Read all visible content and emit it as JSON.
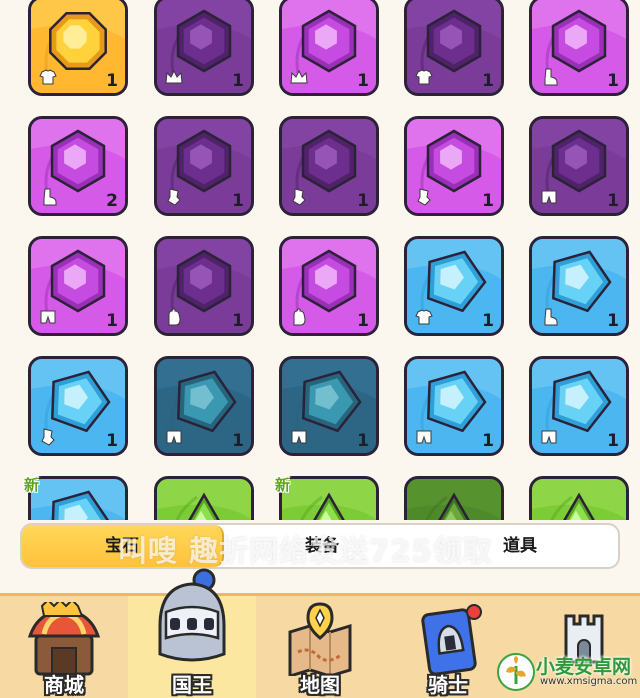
{
  "inventory": {
    "new_tag": "新",
    "items": [
      {
        "rarity": "legendary",
        "shape": "octagon",
        "slot": "shirt-icon",
        "count": "1",
        "new": false
      },
      {
        "rarity": "epic-dark",
        "shape": "hexagon",
        "slot": "crown-icon",
        "count": "1",
        "new": false
      },
      {
        "rarity": "epic",
        "shape": "hexagon",
        "slot": "crown-icon",
        "count": "1",
        "new": false
      },
      {
        "rarity": "epic-dark",
        "shape": "hexagon",
        "slot": "shirt-icon",
        "count": "1",
        "new": false
      },
      {
        "rarity": "epic",
        "shape": "hexagon",
        "slot": "boot-icon",
        "count": "1",
        "new": false
      },
      {
        "rarity": "epic",
        "shape": "hexagon",
        "slot": "boot-icon",
        "count": "2",
        "new": false
      },
      {
        "rarity": "epic-dark",
        "shape": "hexagon",
        "slot": "gauntlet-icon",
        "count": "1",
        "new": false
      },
      {
        "rarity": "epic-dark",
        "shape": "hexagon",
        "slot": "gauntlet-icon",
        "count": "1",
        "new": false
      },
      {
        "rarity": "epic",
        "shape": "hexagon",
        "slot": "gauntlet-icon",
        "count": "1",
        "new": false
      },
      {
        "rarity": "epic-dark",
        "shape": "hexagon",
        "slot": "shorts-icon",
        "count": "1",
        "new": false
      },
      {
        "rarity": "epic",
        "shape": "hexagon",
        "slot": "shorts-icon",
        "count": "1",
        "new": false
      },
      {
        "rarity": "epic-dark",
        "shape": "hexagon",
        "slot": "glove-icon",
        "count": "1",
        "new": false
      },
      {
        "rarity": "epic",
        "shape": "hexagon",
        "slot": "glove-icon",
        "count": "1",
        "new": false
      },
      {
        "rarity": "rare",
        "shape": "pentagon",
        "slot": "shirt-icon",
        "count": "1",
        "new": false
      },
      {
        "rarity": "rare",
        "shape": "pentagon",
        "slot": "boot-icon",
        "count": "1",
        "new": false
      },
      {
        "rarity": "rare",
        "shape": "pentagon",
        "slot": "gauntlet-icon",
        "count": "1",
        "new": false
      },
      {
        "rarity": "rare-dark",
        "shape": "pentagon",
        "slot": "shorts-icon",
        "count": "1",
        "new": false
      },
      {
        "rarity": "rare-dark",
        "shape": "pentagon",
        "slot": "shorts-icon",
        "count": "1",
        "new": false
      },
      {
        "rarity": "rare",
        "shape": "pentagon",
        "slot": "shorts-icon",
        "count": "1",
        "new": false
      },
      {
        "rarity": "rare",
        "shape": "pentagon",
        "slot": "shorts-icon",
        "count": "1",
        "new": false
      },
      {
        "rarity": "rare",
        "shape": "pentagon",
        "slot": "",
        "count": "",
        "new": true
      },
      {
        "rarity": "uncommon",
        "shape": "triangle",
        "slot": "",
        "count": "",
        "new": false
      },
      {
        "rarity": "uncommon",
        "shape": "triangle",
        "slot": "",
        "count": "",
        "new": true
      },
      {
        "rarity": "uncommon-dark",
        "shape": "triangle",
        "slot": "",
        "count": "",
        "new": false
      },
      {
        "rarity": "uncommon",
        "shape": "triangle",
        "slot": "",
        "count": "",
        "new": false
      }
    ]
  },
  "tabs": {
    "gems": "宝石",
    "equipment": "装备",
    "items": "道具"
  },
  "watermark": "叫嗖 趣折网络发送725领取",
  "nav": {
    "shop": "商城",
    "king": "国王",
    "map": "地图",
    "knight": "骑士"
  },
  "brand": {
    "name": "小麦安卓网",
    "url": "www.xmsigma.com"
  },
  "colors": {
    "legendary": "#ffb830",
    "epic": "#d65ae8",
    "epic-dark": "#7a3c98",
    "rare": "#4cb6f0",
    "rare-dark": "#2d6585",
    "uncommon": "#7ccc36",
    "uncommon-dark": "#4f8a2a",
    "active_tab": "#ffc93f"
  }
}
